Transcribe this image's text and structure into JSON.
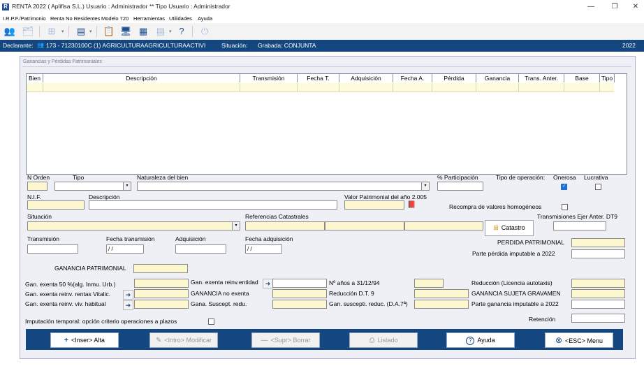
{
  "window": {
    "logo": "R",
    "title": "RENTA 2022  ( Aplifisa S.L.) Usuario : Administrador  **  Tipo Usuario : Administrador",
    "minimize": "—",
    "restore": "❐",
    "close": "✕"
  },
  "menu": [
    "I.R.P.F./Patrimonio",
    "Renta No Residentes",
    "Modelo 720",
    "Herramientas",
    "Utilidades",
    "Ayuda"
  ],
  "declarante": {
    "label": "Declarante:",
    "value": "173 - 71230100C  (1)  AGRICULTURAAGRICULTURAACTIVI",
    "situacion_label": "Situación:",
    "situacion_value": "Grabada: CONJUNTA",
    "year": "2022"
  },
  "panel": {
    "title": "Ganancias y Pérdidas Patrimoniales"
  },
  "grid": {
    "columns": [
      "Bien",
      "Descripción",
      "Transmisión",
      "Fecha T.",
      "Adquisición",
      "Fecha A.",
      "Pérdida",
      "Ganancia",
      "Trans. Anter.",
      "Base",
      "Tipo"
    ]
  },
  "form": {
    "n_orden": "N Orden",
    "tipo": "Tipo",
    "naturaleza": "Naturaleza del bien",
    "participacion": "% Participación",
    "tipo_operacion": "Tipo de operación:",
    "onerosa": "Onerosa",
    "lucrativa": "Lucrativa",
    "nif": "N.I.F.",
    "descripcion": "Descripción",
    "valor_patrimonial": "Valor Patrimonial del año 2.005",
    "recompra": "Recompra de valores homogéneos",
    "situacion": "Situación",
    "referencias": "Referencias Catastrales",
    "catastro": "Catastro",
    "transmisiones_ejer": "Transmisiones Ejer Anter. DT9",
    "transmision": "Transmisión",
    "fecha_transmision": "Fecha transmisión",
    "fecha_transmision_value": " / /",
    "adquisicion": "Adquisición",
    "fecha_adquisicion": "Fecha adquisición",
    "fecha_adquisicion_value": " / /",
    "perdida_patrimonial": "PERDIDA PATRIMONIAL",
    "parte_perdida": "Parte pérdida imputable a 2022",
    "ganancia_patrimonial": "GANANCIA PATRIMONIAL",
    "gan_exenta_50": "Gan. exenta 50 %(alg. Inmu. Urb.)",
    "gan_exenta_rentas": "Gan. exenta reinv. rentas Vitalic.",
    "gan_exenta_viv": "Gan. exenta reinv. viv. habitual",
    "gan_exenta_reinv": "Gan.  exenta reinv.entidad",
    "ganancia_no_exenta": "GANANCIA no exenta",
    "gana_suscept": "Gana. Suscept. redu.",
    "n_anos": "Nº años a 31/12/94",
    "reduccion_dt9": "Reducción D.T. 9",
    "gan_suscept_reduc": "Gan. suscepti. reduc. (D.A.7ª)",
    "reduccion_licencia": "Reducción (Licencia autotaxis)",
    "ganancia_sujeta": "GANANCIA SUJETA GRAVAMEN",
    "parte_ganancia": "Parte ganancia imputable a 2022",
    "imputacion": "Imputación temporal: opción criterio operaciones a plazos",
    "retencion": "Retención"
  },
  "buttons": {
    "alta": "<Inser> Alta",
    "modificar": "<Intro> Modificar",
    "borrar": "<Supr> Borrar",
    "listado": "Listado",
    "ayuda": "Ayuda",
    "menu": "<ESC> Menu"
  },
  "icons": {
    "plus": "+",
    "pencil": "✎",
    "minus": "—",
    "print": "⎙",
    "help": "?",
    "close_circle": "⊗",
    "arrow": "➜",
    "check": "✓",
    "dropdown": "▾",
    "toolbar_power": "⏻",
    "toolbar_help": "?",
    "toolbar_calc": "▦",
    "toolbar_clipboard": "📋",
    "toolbar_monitor": "🖥",
    "toolbar_doc": "▤",
    "toolbar_grid": "⊞",
    "toolbar_person": "👥",
    "toolbar_folder": "🗂",
    "book": "📕"
  },
  "colors": {
    "accent": "#14467f",
    "input_yellow": "#fdf7d0",
    "panel_bg": "#eef0f6"
  }
}
